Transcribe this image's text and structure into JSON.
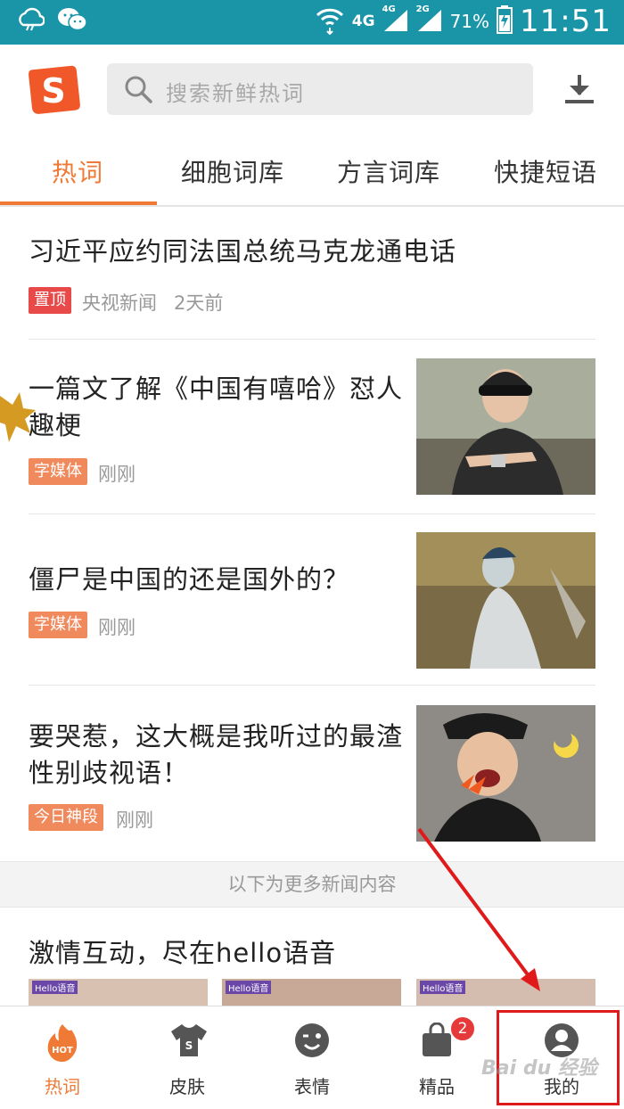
{
  "status_bar": {
    "network": "4G",
    "signal1_tag": "4G",
    "signal2_tag": "2G",
    "battery": "71%",
    "time": "11:51"
  },
  "header": {
    "logo_letter": "S",
    "search_placeholder": "搜索新鲜热词"
  },
  "tabs": [
    {
      "label": "热词"
    },
    {
      "label": "细胞词库"
    },
    {
      "label": "方言词库"
    },
    {
      "label": "快捷短语"
    }
  ],
  "news": [
    {
      "title": "习近平应约同法国总统马克龙通电话",
      "tag": "置顶",
      "source": "央视新闻",
      "time": "2天前"
    },
    {
      "title": "一篇文了解《中国有嘻哈》怼人趣梗",
      "tag": "字媒体",
      "time": "刚刚"
    },
    {
      "title": "僵尸是中国的还是国外的？",
      "tag": "字媒体",
      "time": "刚刚"
    },
    {
      "title": "要哭惹，这大概是我听过的最渣性别歧视语！",
      "tag": "今日神段",
      "time": "刚刚"
    }
  ],
  "more_text": "以下为更多新闻内容",
  "hello": {
    "title": "激情互动，尽在hello语音",
    "badge": "Hello语音"
  },
  "bottom_nav": [
    {
      "label": "热词",
      "icon_text": "HOT"
    },
    {
      "label": "皮肤",
      "icon_text": "S"
    },
    {
      "label": "表情"
    },
    {
      "label": "精品",
      "badge": "2"
    },
    {
      "label": "我的"
    }
  ],
  "watermark": "Bai du 经验",
  "colors": {
    "accent": "#ef7a35",
    "status_bar": "#1a95a8",
    "pin_tag": "#e84a4a",
    "media_tag": "#f08a5d",
    "highlight": "#e01a1a"
  }
}
